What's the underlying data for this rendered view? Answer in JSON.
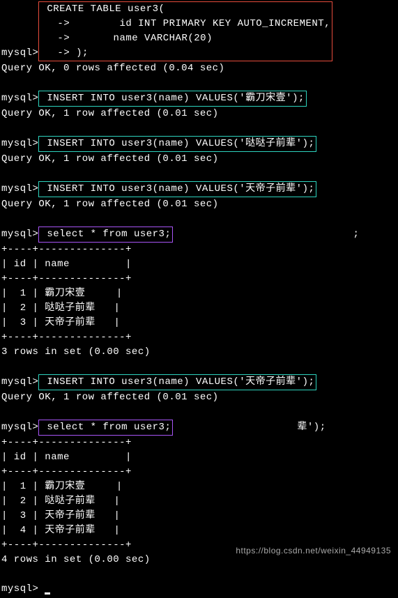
{
  "prompt1": "mysql>",
  "arrow_prefix": "    ->",
  "create_table": {
    "l1": " CREATE TABLE user3(",
    "l2": "        id INT PRIMARY KEY AUTO_INCREMENT,",
    "l3": "       name VARCHAR(20)",
    "l4": " );"
  },
  "result_create": "Query OK, 0 rows affected (0.04 sec)",
  "insert1": " INSERT INTO user3(name) VALUES('霸刀宋壹');",
  "result_insert1": "Query OK, 1 row affected (0.01 sec)",
  "insert2": " INSERT INTO user3(name) VALUES('哒哒子前辈');",
  "result_insert2": "Query OK, 1 row affected (0.01 sec)",
  "insert3": " INSERT INTO user3(name) VALUES('天帝子前辈');",
  "result_insert3": "Query OK, 1 row affected (0.01 sec)",
  "select1": " select * from user3;",
  "trailing_semicolon": ";",
  "table1": {
    "border": "+----+--------------+",
    "header": "| id | name         |",
    "r1": "|  1 | 霸刀宋壹     |",
    "r2": "|  2 | 哒哒子前辈   |",
    "r3": "|  3 | 天帝子前辈   |"
  },
  "rows1_result": "3 rows in set (0.00 sec)",
  "insert4": " INSERT INTO user3(name) VALUES('天帝子前辈');",
  "result_insert4": "Query OK, 1 row affected (0.01 sec)",
  "select2": " select * from user3;",
  "trail2": "辈');",
  "table2": {
    "border": "+----+--------------+",
    "header": "| id | name         |",
    "r1": "|  1 | 霸刀宋壹     |",
    "r2": "|  2 | 哒哒子前辈   |",
    "r3": "|  3 | 天帝子前辈   |",
    "r4": "|  4 | 天帝子前辈   |"
  },
  "rows2_result": "4 rows in set (0.00 sec)",
  "watermark": "https://blog.csdn.net/weixin_44949135"
}
